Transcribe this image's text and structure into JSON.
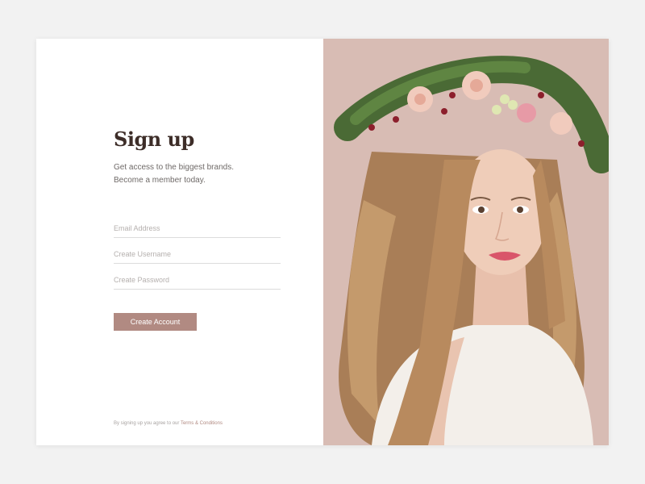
{
  "signup": {
    "title": "Sign up",
    "subtitle_line1": "Get access to the biggest brands.",
    "subtitle_line2": "Become a member today.",
    "email_placeholder": "Email Address",
    "username_placeholder": "Create Username",
    "password_placeholder": "Create Password",
    "button_label": "Create Account",
    "terms_prefix": "By signing up you agree to our",
    "terms_link": "Terms & Conditions"
  },
  "photo": {
    "subject": "woman-with-flower-crown"
  },
  "colors": {
    "accent": "#b18a82",
    "title": "#3d2d28",
    "page_background": "#f2f2f2",
    "photo_background": "#d8bcb4"
  }
}
